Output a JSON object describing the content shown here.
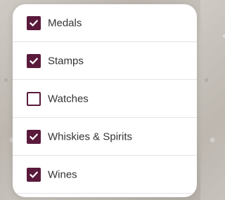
{
  "accent_color": "#5a1a3c",
  "filters": {
    "items": [
      {
        "label": "Medals",
        "checked": true
      },
      {
        "label": "Stamps",
        "checked": true
      },
      {
        "label": "Watches",
        "checked": false
      },
      {
        "label": "Whiskies & Spirits",
        "checked": true
      },
      {
        "label": "Wines",
        "checked": true
      }
    ]
  }
}
